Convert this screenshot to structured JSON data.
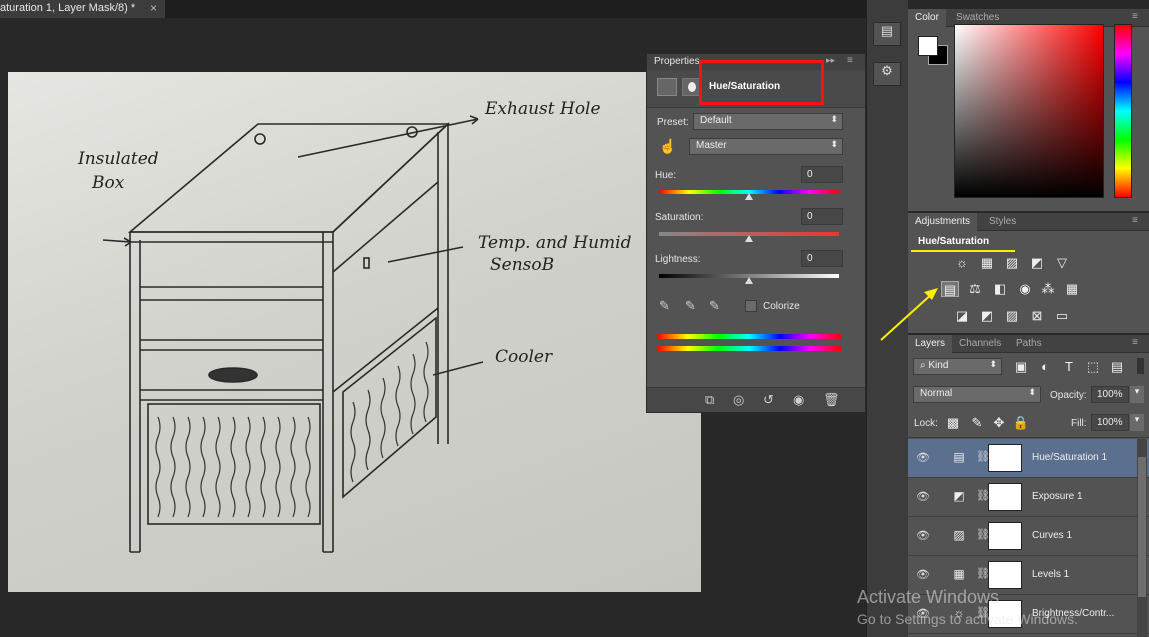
{
  "document_tab": {
    "title": "aturation 1, Layer Mask/8) *",
    "close": "×"
  },
  "sketch_labels": {
    "exhaust": "Exhaust Hole",
    "insulated_1": "Insulated",
    "insulated_2": "Box",
    "temp_1": "Temp. and Humid",
    "temp_2": "SensoB",
    "cooler": "Cooler"
  },
  "properties": {
    "title": "Properties",
    "collapse_glyph": "▸▸",
    "menu_glyph": "≡",
    "adjustment_name": "Hue/Saturation",
    "preset_label": "Preset:",
    "preset_value": "Default",
    "channel_value": "Master",
    "hue_label": "Hue:",
    "hue_value": "0",
    "saturation_label": "Saturation:",
    "saturation_value": "0",
    "lightness_label": "Lightness:",
    "lightness_value": "0",
    "colorize_label": "Colorize"
  },
  "color_panel": {
    "tabs": [
      "Color",
      "Swatches"
    ],
    "foreground": "#ffffff",
    "background": "#000000"
  },
  "adjustments_panel": {
    "tabs": [
      "Adjustments",
      "Styles"
    ],
    "hover_label": "Hue/Saturation",
    "row1": [
      "brightness-icon",
      "levels-icon",
      "curves-icon",
      "exposure-icon",
      "vibrance-icon"
    ],
    "row2": [
      "hue-saturation-icon",
      "color-balance-icon",
      "black-white-icon",
      "photo-filter-icon",
      "channel-mixer-icon",
      "color-lookup-icon"
    ],
    "row3": [
      "invert-icon",
      "posterize-icon",
      "threshold-icon",
      "selective-color-icon",
      "gradient-map-icon"
    ]
  },
  "layers_panel": {
    "tabs": [
      "Layers",
      "Channels",
      "Paths"
    ],
    "filter_kind": "Kind",
    "blend_mode": "Normal",
    "opacity_label": "Opacity:",
    "opacity_value": "100%",
    "lock_label": "Lock:",
    "fill_label": "Fill:",
    "fill_value": "100%",
    "layers": [
      {
        "name": "Hue/Saturation 1",
        "icon": "hue-saturation-icon",
        "selected": true
      },
      {
        "name": "Exposure 1",
        "icon": "exposure-icon",
        "selected": false
      },
      {
        "name": "Curves 1",
        "icon": "curves-icon",
        "selected": false
      },
      {
        "name": "Levels 1",
        "icon": "levels-icon",
        "selected": false
      },
      {
        "name": "Brightness/Contr...",
        "icon": "brightness-icon",
        "selected": false
      }
    ]
  },
  "watermark": {
    "line1": "Activate Windows",
    "line2": "Go to Settings to activate Windows."
  },
  "annotation_colors": {
    "red_box": "#ff1010",
    "yellow_arrow": "#ffee00"
  }
}
